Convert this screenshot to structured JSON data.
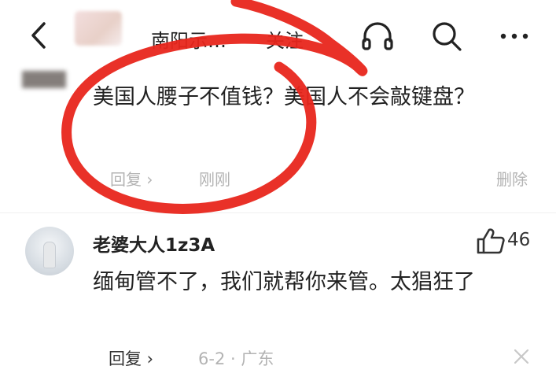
{
  "header": {
    "title": "南阳示…",
    "follow_label": "关注"
  },
  "comment_top": {
    "text": "美国人腰子不值钱？美国人不会敲键盘？",
    "reply_label": "回复 ›",
    "time": "刚刚",
    "delete_label": "删除"
  },
  "comment_main": {
    "username": "老婆大人1z3A",
    "likes": "46",
    "text": "缅甸管不了，我们就帮你来管。太猖狂了",
    "reply_label": "回复 ›",
    "meta": "6-2 · 广东"
  },
  "annotation": {
    "color": "#e8261c"
  }
}
